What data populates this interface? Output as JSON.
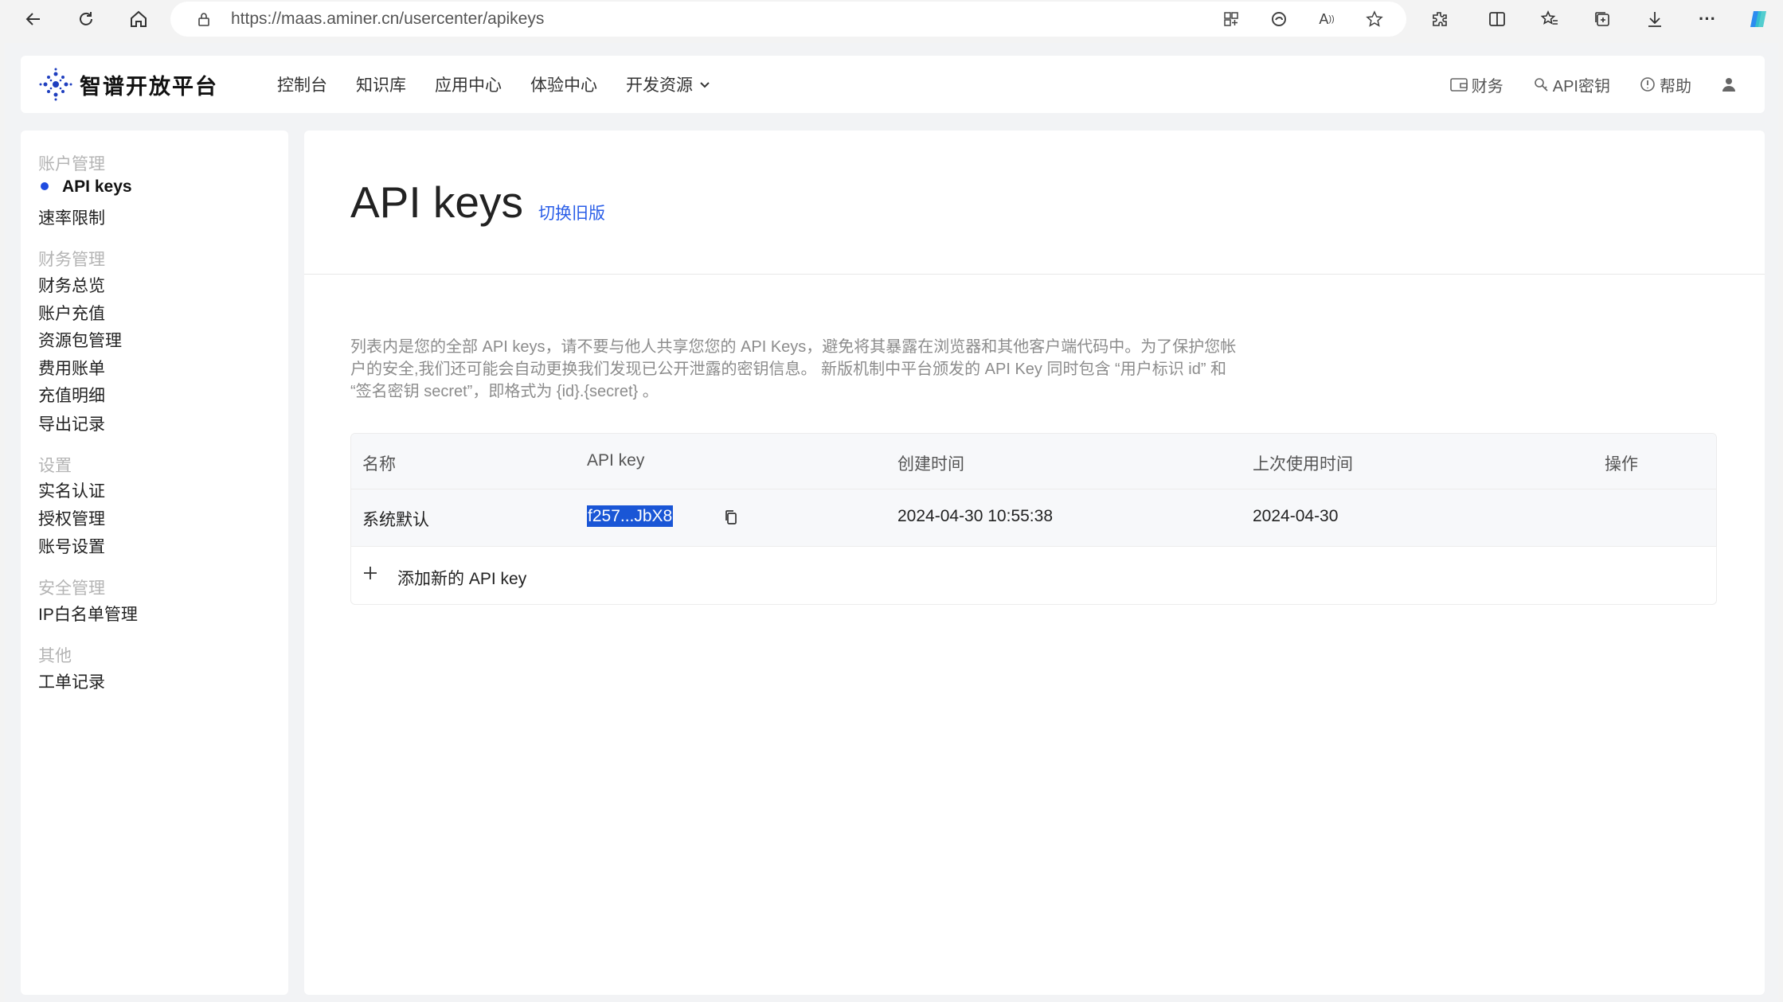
{
  "browser": {
    "url": "https://maas.aminer.cn/usercenter/apikeys"
  },
  "header": {
    "logo_text": "智谱开放平台",
    "nav": [
      "控制台",
      "知识库",
      "应用中心",
      "体验中心",
      "开发资源"
    ],
    "right_nav": {
      "finance": "财务",
      "api_key": "API密钥",
      "help": "帮助"
    }
  },
  "sidebar": {
    "groups": [
      {
        "title": "账户管理",
        "items": [
          "API keys",
          "速率限制"
        ]
      },
      {
        "title": "财务管理",
        "items": [
          "财务总览",
          "账户充值",
          "资源包管理",
          "费用账单",
          "充值明细",
          "导出记录"
        ]
      },
      {
        "title": "设置",
        "items": [
          "实名认证",
          "授权管理",
          "账号设置"
        ]
      },
      {
        "title": "安全管理",
        "items": [
          "IP白名单管理"
        ]
      },
      {
        "title": "其他",
        "items": [
          "工单记录"
        ]
      }
    ],
    "active_item": "API keys"
  },
  "main": {
    "title": "API keys",
    "switch_link": "切换旧版",
    "description": "列表内是您的全部 API keys，请不要与他人共享您您的 API Keys，避免将其暴露在浏览器和其他客户端代码中。为了保护您帐户的安全,我们还可能会自动更换我们发现已公开泄露的密钥信息。 新版机制中平台颁发的 API Key 同时包含 “用户标识 id” 和 “签名密钥 secret”，即格式为 {id}.{secret} 。",
    "table": {
      "headers": [
        "名称",
        "API key",
        "创建时间",
        "上次使用时间",
        "操作"
      ],
      "rows": [
        {
          "name": "系统默认",
          "api_key": "f257...JbX8",
          "created": "2024-04-30 10:55:38",
          "last_used": "2024-04-30"
        }
      ],
      "add_label": "添加新的 API key"
    }
  }
}
